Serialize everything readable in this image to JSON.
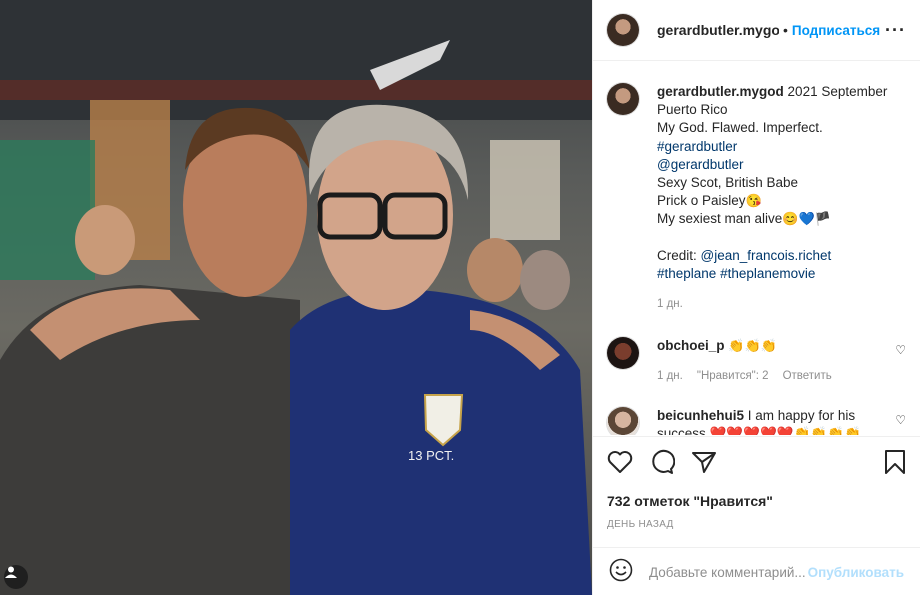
{
  "header": {
    "username": "gerardbutler.mygoc",
    "separator": "•",
    "follow": "Подписаться",
    "more": "···"
  },
  "caption": {
    "username": "gerardbutler.mygod",
    "line1": "2021 September",
    "line2": "Puerto Rico",
    "line3": "My God. Flawed. Imperfect.",
    "tag1": "#gerardbutler",
    "mention1": "@gerardbutler",
    "line4": "Sexy Scot, British Babe",
    "line5": "Prick o Paisley",
    "line5_emoji": "😘",
    "line6": "My sexiest man alive",
    "line6_emoji": "😊💙🏴",
    "credit_label": "Credit:",
    "credit_mention": "@jean_francois.richet",
    "tag2": "#theplane",
    "tag3": "#theplanemovie",
    "time": "1 дн."
  },
  "comments": [
    {
      "username": "obchoei_p",
      "text": "👏👏👏",
      "time": "1 дн.",
      "likes": "\"Нравится\": 2",
      "reply": "Ответить"
    },
    {
      "username": "beicunhehui5",
      "text": "I am happy for his success ❤️❤️❤️❤️❤️👏👏👏👏"
    }
  ],
  "likes_text": "732 отметок \"Нравится\"",
  "posted_ago": "день назад",
  "composer": {
    "placeholder": "Добавьте комментарий...",
    "publish": "Опубликовать"
  },
  "icons": [
    "heart-icon",
    "comment-icon",
    "share-icon",
    "bookmark-icon",
    "emoji-icon",
    "user-tag-icon"
  ]
}
